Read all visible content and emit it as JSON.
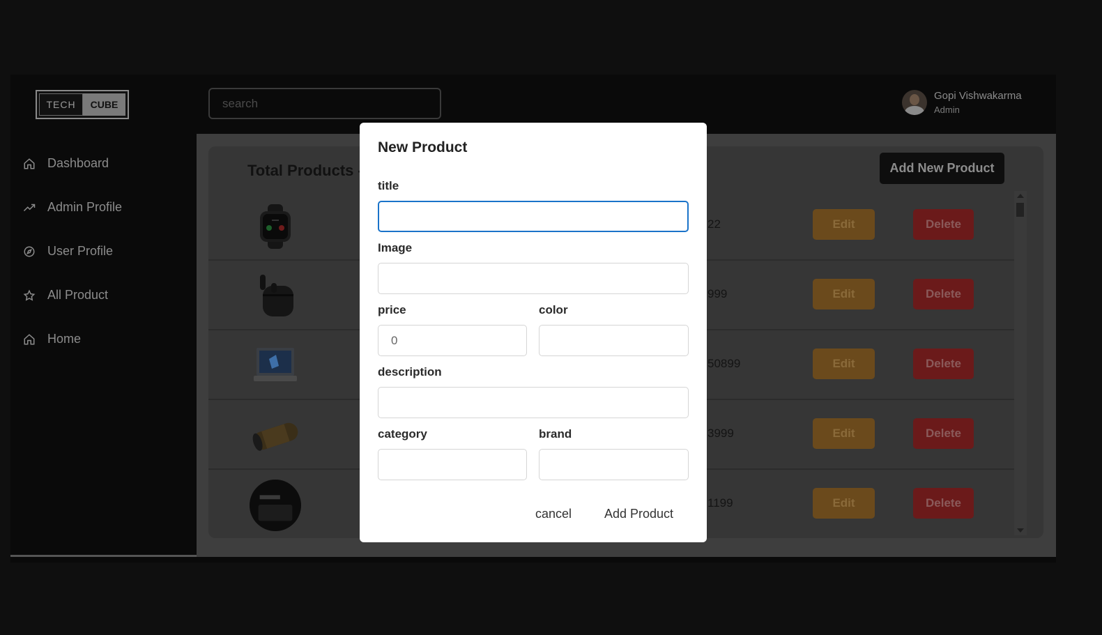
{
  "brand": {
    "part1": "TECH",
    "part2": "CUBE"
  },
  "search": {
    "placeholder": "search"
  },
  "user": {
    "name": "Gopi Vishwakarma",
    "role": "Admin"
  },
  "sidebar": {
    "items": [
      {
        "label": "Dashboard",
        "icon": "home-icon"
      },
      {
        "label": "Admin Profile",
        "icon": "trending-up-icon"
      },
      {
        "label": "User Profile",
        "icon": "compass-icon"
      },
      {
        "label": "All Product",
        "icon": "star-icon"
      },
      {
        "label": "Home",
        "icon": "home-icon"
      }
    ]
  },
  "main": {
    "title": "Total Products -",
    "add_button": "Add New Product",
    "rows": [
      {
        "product": "smartwatch",
        "price": "22",
        "edit": "Edit",
        "delete": "Delete"
      },
      {
        "product": "earbuds",
        "price": "999",
        "edit": "Edit",
        "delete": "Delete"
      },
      {
        "product": "laptop",
        "price": "50899",
        "edit": "Edit",
        "delete": "Delete"
      },
      {
        "product": "bluetooth speaker",
        "price": "3999",
        "edit": "Edit",
        "delete": "Delete"
      },
      {
        "product": "20W charger",
        "price": "1199",
        "edit": "Edit",
        "delete": "Delete"
      }
    ]
  },
  "modal": {
    "title": "New Product",
    "fields": {
      "title": {
        "label": "title",
        "value": ""
      },
      "image": {
        "label": "Image",
        "value": ""
      },
      "price": {
        "label": "price",
        "value": "0"
      },
      "color": {
        "label": "color",
        "value": ""
      },
      "description": {
        "label": "description",
        "value": ""
      },
      "category": {
        "label": "category",
        "value": ""
      },
      "brand": {
        "label": "brand",
        "value": ""
      }
    },
    "cancel": "cancel",
    "submit": "Add Product"
  },
  "colors": {
    "focus_border": "#1a73c9",
    "edit": "#6b4a1c",
    "delete": "#6b1a1a"
  }
}
